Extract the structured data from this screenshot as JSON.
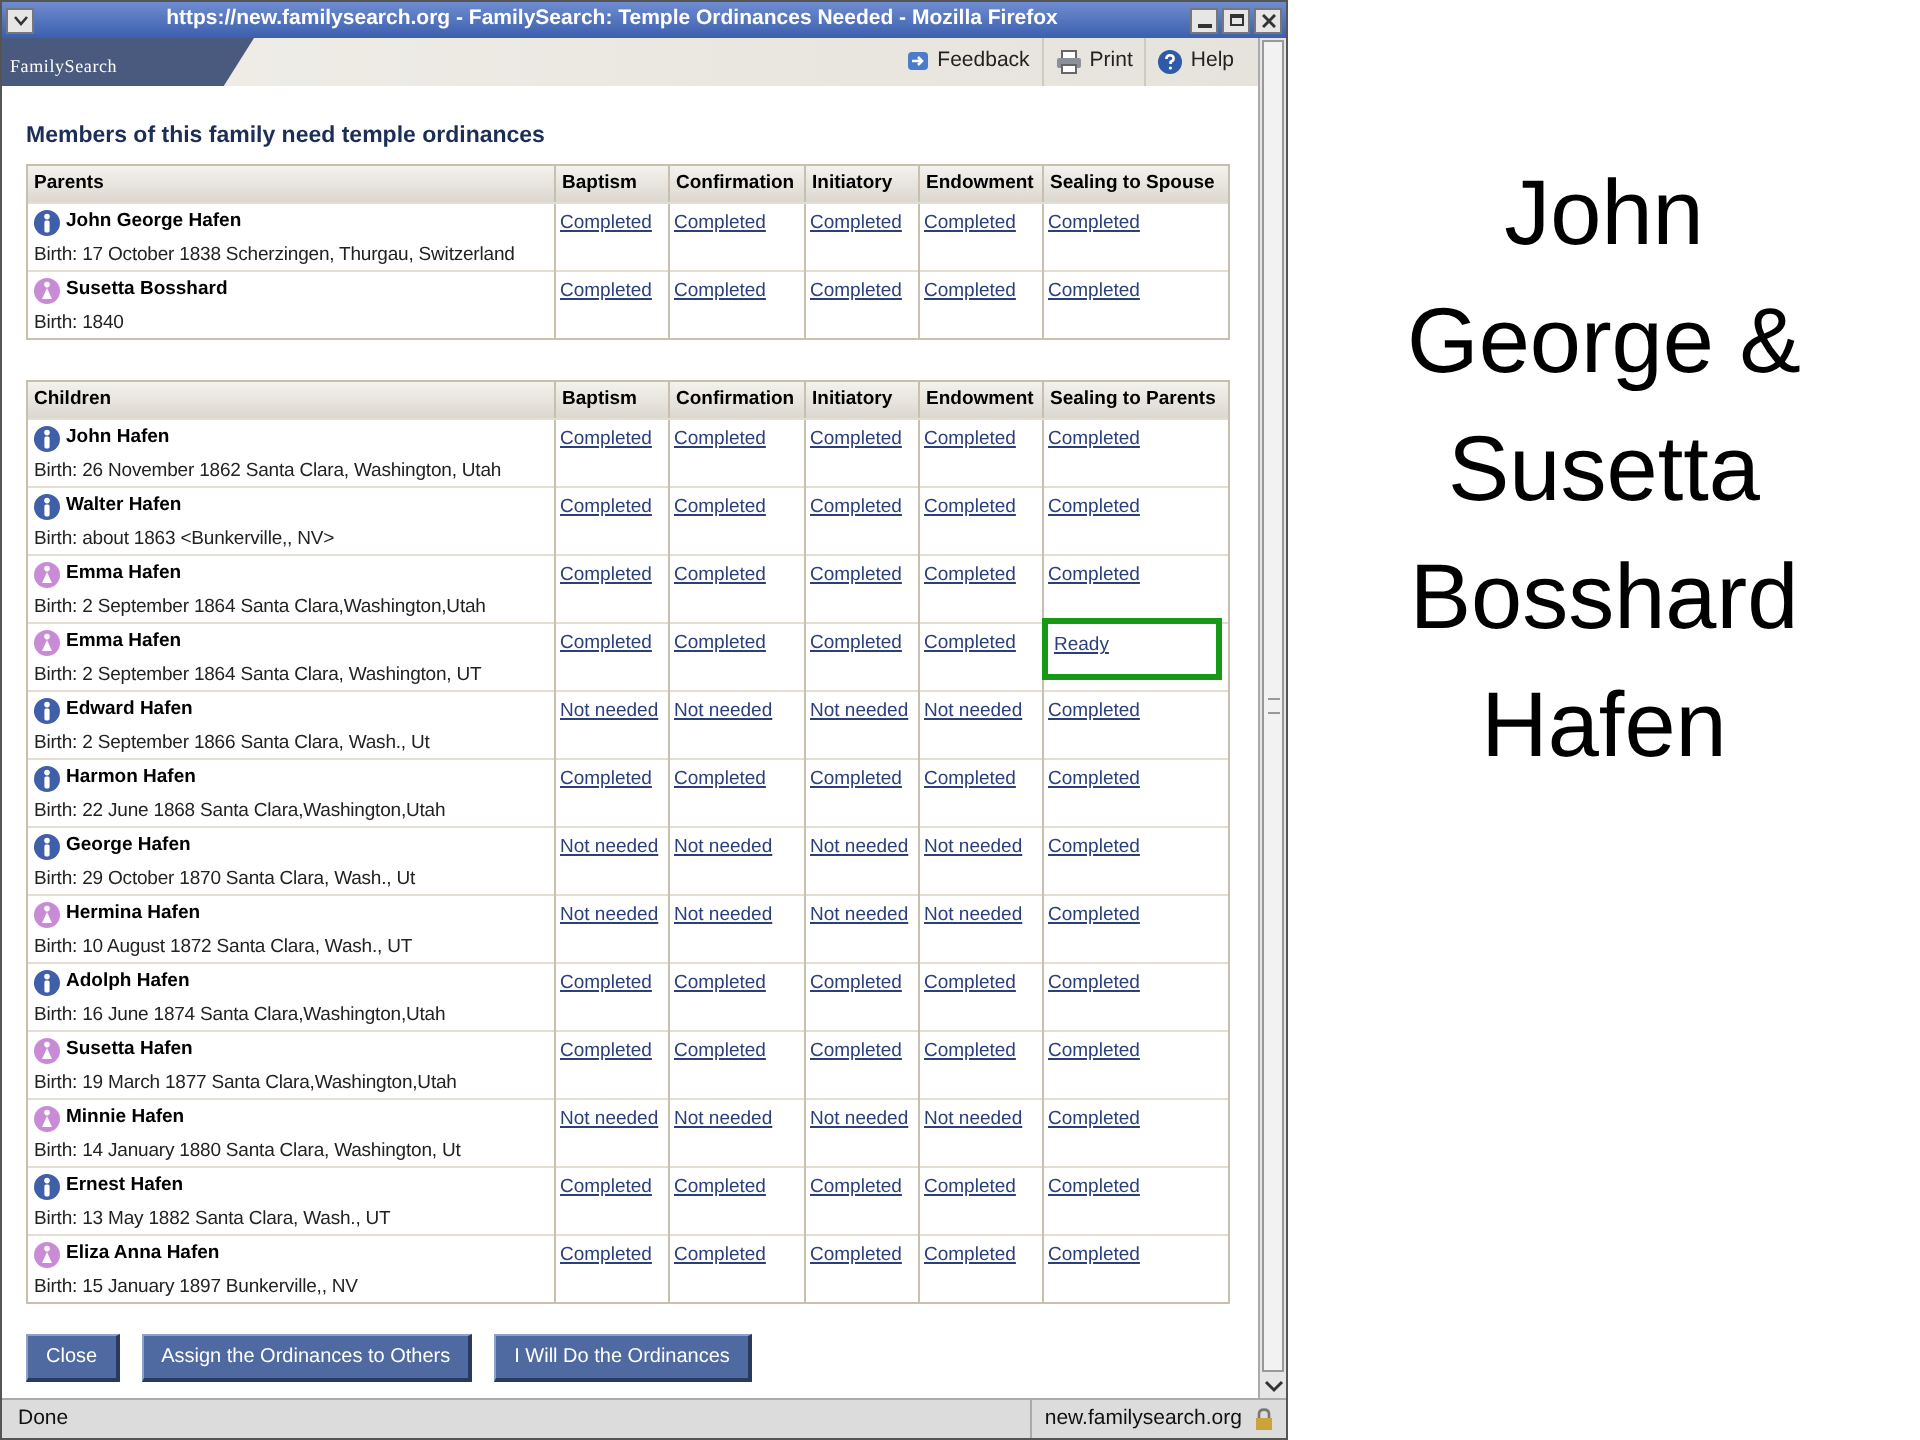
{
  "window": {
    "title": "https://new.familysearch.org - FamilySearch: Temple Ordinances Needed - Mozilla Firefox"
  },
  "header": {
    "logo": "FamilySearch",
    "links": [
      {
        "kind": "feedback",
        "label": "Feedback"
      },
      {
        "kind": "print",
        "label": "Print"
      },
      {
        "kind": "help",
        "label": "Help"
      }
    ]
  },
  "heading": "Members of this family need temple ordinances",
  "tables": [
    {
      "columns": [
        "Parents",
        "Baptism",
        "Confirmation",
        "Initiatory",
        "Endowment",
        "Sealing to Spouse"
      ],
      "rows": [
        {
          "cells": [
            {
              "kind": "male",
              "name": "John George Hafen",
              "birth": "Birth: 17 October 1838 Scherzingen, Thurgau, Switzerland"
            },
            {
              "text": "Completed",
              "highlighted": false
            },
            {
              "text": "Completed",
              "highlighted": false
            },
            {
              "text": "Completed",
              "highlighted": false
            },
            {
              "text": "Completed",
              "highlighted": false
            },
            {
              "text": "Completed",
              "highlighted": false
            }
          ]
        },
        {
          "cells": [
            {
              "kind": "female",
              "name": "Susetta Bosshard",
              "birth": "Birth: 1840"
            },
            {
              "text": "Completed",
              "highlighted": false
            },
            {
              "text": "Completed",
              "highlighted": false
            },
            {
              "text": "Completed",
              "highlighted": false
            },
            {
              "text": "Completed",
              "highlighted": false
            },
            {
              "text": "Completed",
              "highlighted": false
            }
          ]
        }
      ]
    },
    {
      "columns": [
        "Children",
        "Baptism",
        "Confirmation",
        "Initiatory",
        "Endowment",
        "Sealing to Parents"
      ],
      "rows": [
        {
          "cells": [
            {
              "kind": "male",
              "name": "John Hafen",
              "birth": "Birth: 26 November 1862 Santa Clara, Washington, Utah"
            },
            {
              "text": "Completed",
              "highlighted": false
            },
            {
              "text": "Completed",
              "highlighted": false
            },
            {
              "text": "Completed",
              "highlighted": false
            },
            {
              "text": "Completed",
              "highlighted": false
            },
            {
              "text": "Completed",
              "highlighted": false
            }
          ]
        },
        {
          "cells": [
            {
              "kind": "male",
              "name": "Walter Hafen",
              "birth": "Birth: about 1863 <Bunkerville,, NV>"
            },
            {
              "text": "Completed",
              "highlighted": false
            },
            {
              "text": "Completed",
              "highlighted": false
            },
            {
              "text": "Completed",
              "highlighted": false
            },
            {
              "text": "Completed",
              "highlighted": false
            },
            {
              "text": "Completed",
              "highlighted": false
            }
          ]
        },
        {
          "cells": [
            {
              "kind": "female",
              "name": "Emma Hafen",
              "birth": "Birth: 2 September 1864 Santa Clara,Washington,Utah"
            },
            {
              "text": "Completed",
              "highlighted": false
            },
            {
              "text": "Completed",
              "highlighted": false
            },
            {
              "text": "Completed",
              "highlighted": false
            },
            {
              "text": "Completed",
              "highlighted": false
            },
            {
              "text": "Completed",
              "highlighted": false
            }
          ]
        },
        {
          "cells": [
            {
              "kind": "female",
              "name": "Emma Hafen",
              "birth": "Birth: 2 September 1864 Santa Clara, Washington, UT"
            },
            {
              "text": "Completed",
              "highlighted": false
            },
            {
              "text": "Completed",
              "highlighted": false
            },
            {
              "text": "Completed",
              "highlighted": false
            },
            {
              "text": "Completed",
              "highlighted": false
            },
            {
              "text": "Ready",
              "highlighted": true
            }
          ]
        },
        {
          "cells": [
            {
              "kind": "male",
              "name": "Edward Hafen",
              "birth": "Birth: 2 September 1866 Santa Clara, Wash., Ut"
            },
            {
              "text": "Not needed",
              "highlighted": false
            },
            {
              "text": "Not needed",
              "highlighted": false
            },
            {
              "text": "Not needed",
              "highlighted": false
            },
            {
              "text": "Not needed",
              "highlighted": false
            },
            {
              "text": "Completed",
              "highlighted": false
            }
          ]
        },
        {
          "cells": [
            {
              "kind": "male",
              "name": "Harmon Hafen",
              "birth": "Birth: 22 June 1868 Santa Clara,Washington,Utah"
            },
            {
              "text": "Completed",
              "highlighted": false
            },
            {
              "text": "Completed",
              "highlighted": false
            },
            {
              "text": "Completed",
              "highlighted": false
            },
            {
              "text": "Completed",
              "highlighted": false
            },
            {
              "text": "Completed",
              "highlighted": false
            }
          ]
        },
        {
          "cells": [
            {
              "kind": "male",
              "name": "George Hafen",
              "birth": "Birth: 29 October 1870 Santa Clara, Wash., Ut"
            },
            {
              "text": "Not needed",
              "highlighted": false
            },
            {
              "text": "Not needed",
              "highlighted": false
            },
            {
              "text": "Not needed",
              "highlighted": false
            },
            {
              "text": "Not needed",
              "highlighted": false
            },
            {
              "text": "Completed",
              "highlighted": false
            }
          ]
        },
        {
          "cells": [
            {
              "kind": "female",
              "name": "Hermina Hafen",
              "birth": "Birth: 10 August 1872 Santa Clara, Wash., UT"
            },
            {
              "text": "Not needed",
              "highlighted": false
            },
            {
              "text": "Not needed",
              "highlighted": false
            },
            {
              "text": "Not needed",
              "highlighted": false
            },
            {
              "text": "Not needed",
              "highlighted": false
            },
            {
              "text": "Completed",
              "highlighted": false
            }
          ]
        },
        {
          "cells": [
            {
              "kind": "male",
              "name": "Adolph Hafen",
              "birth": "Birth: 16 June 1874 Santa Clara,Washington,Utah"
            },
            {
              "text": "Completed",
              "highlighted": false
            },
            {
              "text": "Completed",
              "highlighted": false
            },
            {
              "text": "Completed",
              "highlighted": false
            },
            {
              "text": "Completed",
              "highlighted": false
            },
            {
              "text": "Completed",
              "highlighted": false
            }
          ]
        },
        {
          "cells": [
            {
              "kind": "female",
              "name": "Susetta Hafen",
              "birth": "Birth: 19 March 1877 Santa Clara,Washington,Utah"
            },
            {
              "text": "Completed",
              "highlighted": false
            },
            {
              "text": "Completed",
              "highlighted": false
            },
            {
              "text": "Completed",
              "highlighted": false
            },
            {
              "text": "Completed",
              "highlighted": false
            },
            {
              "text": "Completed",
              "highlighted": false
            }
          ]
        },
        {
          "cells": [
            {
              "kind": "female",
              "name": "Minnie Hafen",
              "birth": "Birth: 14 January 1880 Santa Clara, Washington, Ut"
            },
            {
              "text": "Not needed",
              "highlighted": false
            },
            {
              "text": "Not needed",
              "highlighted": false
            },
            {
              "text": "Not needed",
              "highlighted": false
            },
            {
              "text": "Not needed",
              "highlighted": false
            },
            {
              "text": "Completed",
              "highlighted": false
            }
          ]
        },
        {
          "cells": [
            {
              "kind": "male",
              "name": "Ernest Hafen",
              "birth": "Birth: 13 May 1882 Santa Clara, Wash., UT"
            },
            {
              "text": "Completed",
              "highlighted": false
            },
            {
              "text": "Completed",
              "highlighted": false
            },
            {
              "text": "Completed",
              "highlighted": false
            },
            {
              "text": "Completed",
              "highlighted": false
            },
            {
              "text": "Completed",
              "highlighted": false
            }
          ]
        },
        {
          "cells": [
            {
              "kind": "female",
              "name": "Eliza Anna Hafen",
              "birth": "Birth: 15 January 1897 Bunkerville,, NV"
            },
            {
              "text": "Completed",
              "highlighted": false
            },
            {
              "text": "Completed",
              "highlighted": false
            },
            {
              "text": "Completed",
              "highlighted": false
            },
            {
              "text": "Completed",
              "highlighted": false
            },
            {
              "text": "Completed",
              "highlighted": false
            }
          ]
        }
      ]
    }
  ],
  "buttons": [
    "Close",
    "Assign the Ordinances to Others",
    "I Will Do the Ordinances"
  ],
  "status_bar": {
    "status": "Done",
    "domain": "new.familysearch.org"
  },
  "slide_caption": "John George & Susetta Bosshard Hafen"
}
